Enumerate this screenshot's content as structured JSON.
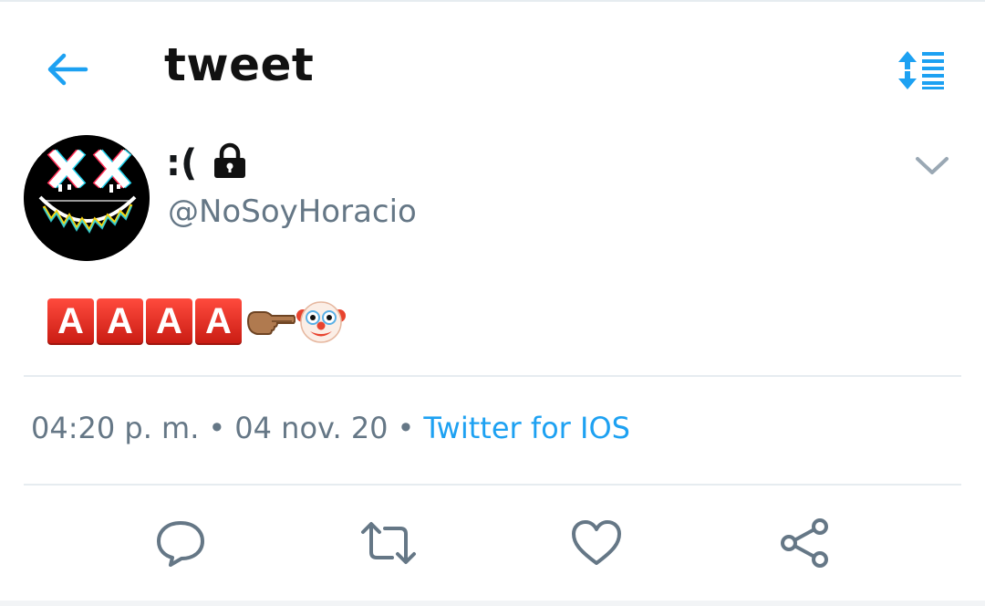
{
  "header": {
    "title": "tweet",
    "back_icon": "arrow-left-icon",
    "sort_icon": "sort-order-icon"
  },
  "author": {
    "display_name": ":(",
    "username": "@NoSoyHoracio",
    "protected_icon": "lock-icon",
    "avatar": "glitch-smiley-avatar"
  },
  "tweet": {
    "letters": [
      "A",
      "A",
      "A",
      "A"
    ],
    "emojis": [
      "pointing-hand-emoji",
      "clown-face-emoji"
    ]
  },
  "meta": {
    "time": "04:20 p. m.",
    "separator": "•",
    "date": "04 nov. 20",
    "source": "Twitter for IOS"
  },
  "actions": [
    "reply-icon",
    "retweet-icon",
    "like-icon",
    "share-icon"
  ],
  "colors": {
    "accent": "#1da1f2",
    "secondary_text": "#657786",
    "icon_gray": "#657786",
    "divider": "#e6ecf0",
    "letter_tile": "#e0261a"
  }
}
